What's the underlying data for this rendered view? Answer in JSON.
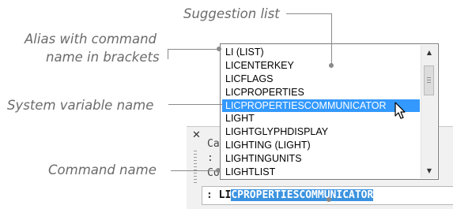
{
  "callouts": {
    "suggestion_list": "Suggestion list",
    "alias_line1": "Alias with command",
    "alias_line2": "name in brackets",
    "system_variable": "System variable name",
    "command_name": "Command name"
  },
  "command_window": {
    "close_glyph": "✕",
    "history": [
      "Ca",
      ":",
      "Co"
    ]
  },
  "command_line": {
    "prompt": ":",
    "typed": "LI",
    "autocomplete": "CPROPERTIESCOMMUNICATOR"
  },
  "suggestion_list": {
    "items": [
      "LI (LIST)",
      "LICENTERKEY",
      "LICFLAGS",
      "LICPROPERTIES",
      "LICPROPERTIESCOMMUNICATOR",
      "LIGHT",
      "LIGHTGLYPHDISPLAY",
      "LIGHTING (LIGHT)",
      "LIGHTINGUNITS",
      "LIGHTLIST"
    ],
    "selected_index": 4
  },
  "scrollbar": {
    "up_glyph": "▲",
    "down_glyph": "▼"
  },
  "icons": {
    "cursor": "pointer-cursor-icon"
  }
}
